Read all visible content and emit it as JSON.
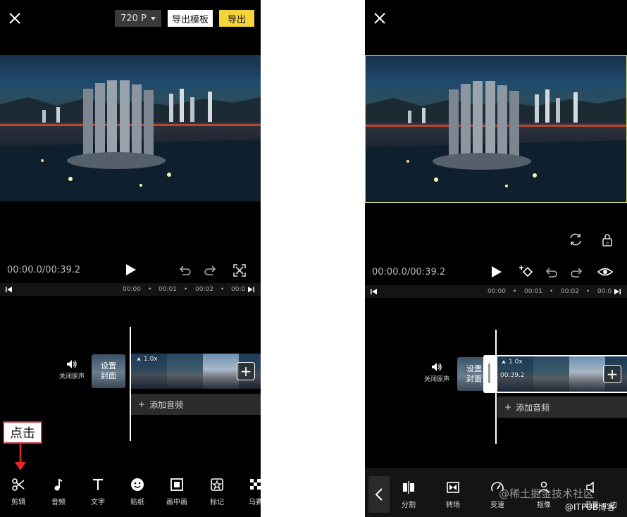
{
  "left": {
    "resolution": "720 P",
    "export_template": "导出模板",
    "export": "导出",
    "time": "00:00.0/00:39.2",
    "ruler": [
      "00:00",
      "00:01",
      "00:02",
      "00:0"
    ],
    "mute_label": "关闭原声",
    "cover_label_1": "设置",
    "cover_label_2": "封面",
    "speed_badge": "1.0x",
    "add_audio": "添加音频",
    "callout": "点击",
    "tools": [
      "剪辑",
      "音频",
      "文字",
      "贴纸",
      "画中画",
      "标记",
      "马赛"
    ]
  },
  "right": {
    "time": "00:00.0/00:39.2",
    "ruler": [
      "00:00",
      "00:01",
      "00:02",
      "00:0"
    ],
    "mute_label": "关闭原声",
    "cover_label_1": "设置",
    "cover_label_2": "封面",
    "speed_badge": "1.0x",
    "clip_duration": "00:39.2",
    "add_audio": "添加音频",
    "tools": [
      "分割",
      "转场",
      "变速",
      "抠像",
      "音量",
      "边"
    ]
  },
  "watermark": {
    "site": "@稀土掘金技术社区",
    "blog": "@ITPUB博客"
  },
  "colors": {
    "accent_yellow": "#f5d33b",
    "callout_red": "#d0202a",
    "selection_border": "#c8d46a"
  }
}
